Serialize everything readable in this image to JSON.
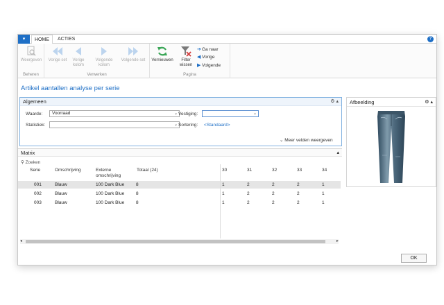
{
  "ribbon": {
    "tabs": [
      "HOME",
      "ACTIES"
    ],
    "groups": {
      "beheren": {
        "label": "Beheren",
        "buttons": [
          "Weergeven"
        ]
      },
      "verwerken": {
        "label": "Verwerken",
        "buttons": [
          "Vorige set",
          "Vorige kolom",
          "Volgende kolom",
          "Volgende set"
        ]
      },
      "pagina": {
        "label": "Pagina",
        "buttons": [
          "Vernieuwen",
          "Filter wissen"
        ],
        "small_buttons": [
          "Ga naar",
          "Vorige",
          "Volgende"
        ]
      }
    }
  },
  "page": {
    "title": "Artikel aantallen analyse per serie"
  },
  "algemeen": {
    "title": "Algemeen",
    "waarde_label": "Waarde:",
    "waarde_value": "Voorraad",
    "statistiek_label": "Statistiek:",
    "statistiek_value": "",
    "vestiging_label": "Vestiging:",
    "vestiging_value": "",
    "sortering_label": "Sortering:",
    "sortering_value": "<Standaard>",
    "more_fields": "Meer velden weergeven"
  },
  "matrix": {
    "title": "Matrix",
    "search": "Zoeken",
    "columns": [
      "Serie",
      "Omschrijving",
      "Externe omschrijving",
      "Totaal (24)",
      "30",
      "31",
      "32",
      "33",
      "34"
    ],
    "rows": [
      [
        "001",
        "Blauw",
        "100 Dark Blue",
        "8",
        "1",
        "2",
        "2",
        "2",
        "1"
      ],
      [
        "002",
        "Blauw",
        "100 Dark Blue",
        "8",
        "1",
        "2",
        "2",
        "2",
        "1"
      ],
      [
        "003",
        "Blauw",
        "100 Dark Blue",
        "8",
        "1",
        "2",
        "2",
        "2",
        "1"
      ]
    ]
  },
  "afbeelding": {
    "title": "Afbeelding"
  },
  "footer": {
    "ok": "OK"
  },
  "colors": {
    "accent": "#1e6fc6",
    "selected_row": "#e5e5e5",
    "refresh_green": "#3aa657"
  }
}
